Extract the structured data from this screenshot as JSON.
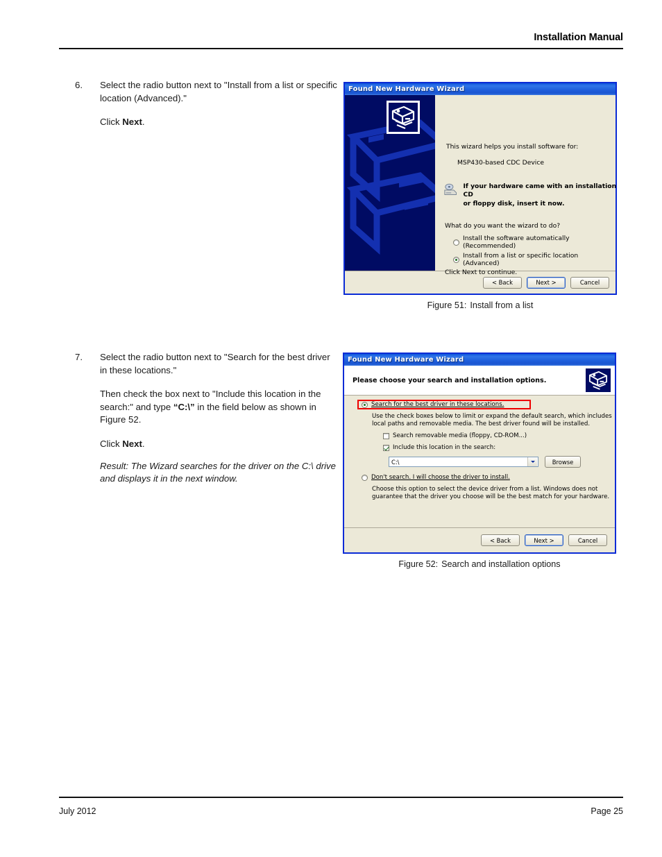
{
  "header": {
    "title": "Installation Manual"
  },
  "footer": {
    "date": "July 2012",
    "page": "Page 25"
  },
  "steps": [
    {
      "number": "6.",
      "line1": "Select the radio button next to \"Install from a list or specific location (Advanced).\"",
      "click_prefix": "Click ",
      "click_bold": "Next",
      "click_suffix": "."
    },
    {
      "number": "7.",
      "line1": "Select the radio button next to \"Search for the best driver in these locations.\"",
      "line2_a": "Then check the box next to \"Include this location in the search:\" and type ",
      "line2_b": "“C:\\”",
      "line2_c": " in the field below as shown in Figure 52.",
      "click_prefix": "Click ",
      "click_bold": "Next",
      "click_suffix": ".",
      "result": "Result: The Wizard searches for the driver on the C:\\ drive and displays it in the next window."
    }
  ],
  "figures": [
    {
      "label": "Figure 51:",
      "caption": "Install from a list",
      "dialog": {
        "title": "Found New Hardware Wizard",
        "intro": "This wizard helps you install software for:",
        "device": "MSP430-based CDC Device",
        "cd_notice_line1": "If your hardware came with an installation CD",
        "cd_notice_line2": "or floppy disk, insert it now.",
        "question": "What do you want the wizard to do?",
        "options": [
          {
            "label": "Install the software automatically (Recommended)",
            "selected": false
          },
          {
            "label": "Install from a list or specific location (Advanced)",
            "selected": true
          }
        ],
        "continue_text": "Click Next to continue.",
        "buttons": [
          {
            "label": "< Back",
            "default": false
          },
          {
            "label": "Next >",
            "default": true
          },
          {
            "label": "Cancel",
            "default": false
          }
        ]
      }
    },
    {
      "label": "Figure 52:",
      "caption": "Search and installation options",
      "dialog": {
        "title": "Found New Hardware Wizard",
        "heading": "Please choose your search and installation options.",
        "option1": {
          "label": "Search for the best driver in these locations.",
          "selected": true,
          "highlighted": true
        },
        "option1_desc": "Use the check boxes below to limit or expand the default search, which includes local paths and removable media. The best driver found will be installed.",
        "check1": {
          "label": "Search removable media (floppy, CD-ROM...)",
          "checked": false
        },
        "check2": {
          "label": "Include this location in the search:",
          "checked": true
        },
        "combo_value": "C:\\",
        "browse_label": "Browse",
        "option2": {
          "label": "Don't search. I will choose the driver to install.",
          "selected": false
        },
        "option2_desc": "Choose this option to select the device driver from a list. Windows does not guarantee that the driver you choose will be the best match for your hardware.",
        "buttons": [
          {
            "label": "< Back",
            "default": false
          },
          {
            "label": "Next >",
            "default": true
          },
          {
            "label": "Cancel",
            "default": false
          }
        ]
      }
    }
  ],
  "colors": {
    "titlebar_blue": "#1F5FDC",
    "dialog_face": "#ECE9D8",
    "sidebar_navy": "#000B63",
    "highlight_red": "#EE0000"
  }
}
